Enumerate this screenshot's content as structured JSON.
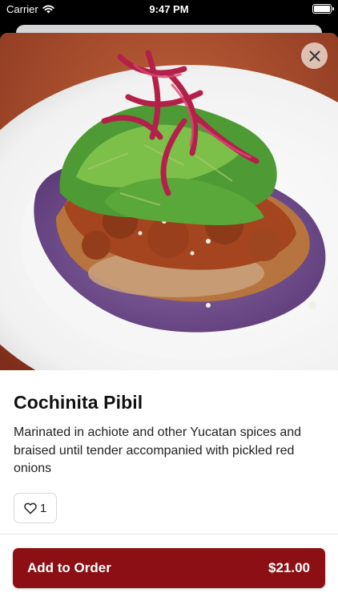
{
  "status_bar": {
    "carrier": "Carrier",
    "time": "9:47 PM"
  },
  "item": {
    "name": "Cochinita Pibil",
    "description": "Marinated in achiote and other Yucatan spices and braised until tender accompanied with pickled red onions",
    "image_alt": "Cochinita Pibil on blue corn tortilla with lettuce and pickled red onions"
  },
  "like": {
    "count": "1"
  },
  "order": {
    "label": "Add to Order",
    "price": "$21.00"
  },
  "colors": {
    "accent": "#8b0f14",
    "close_bg": "#ebd7cd"
  },
  "icons": {
    "close": "close-icon",
    "like": "heart-icon",
    "wifi": "wifi-icon",
    "battery": "battery-icon"
  }
}
